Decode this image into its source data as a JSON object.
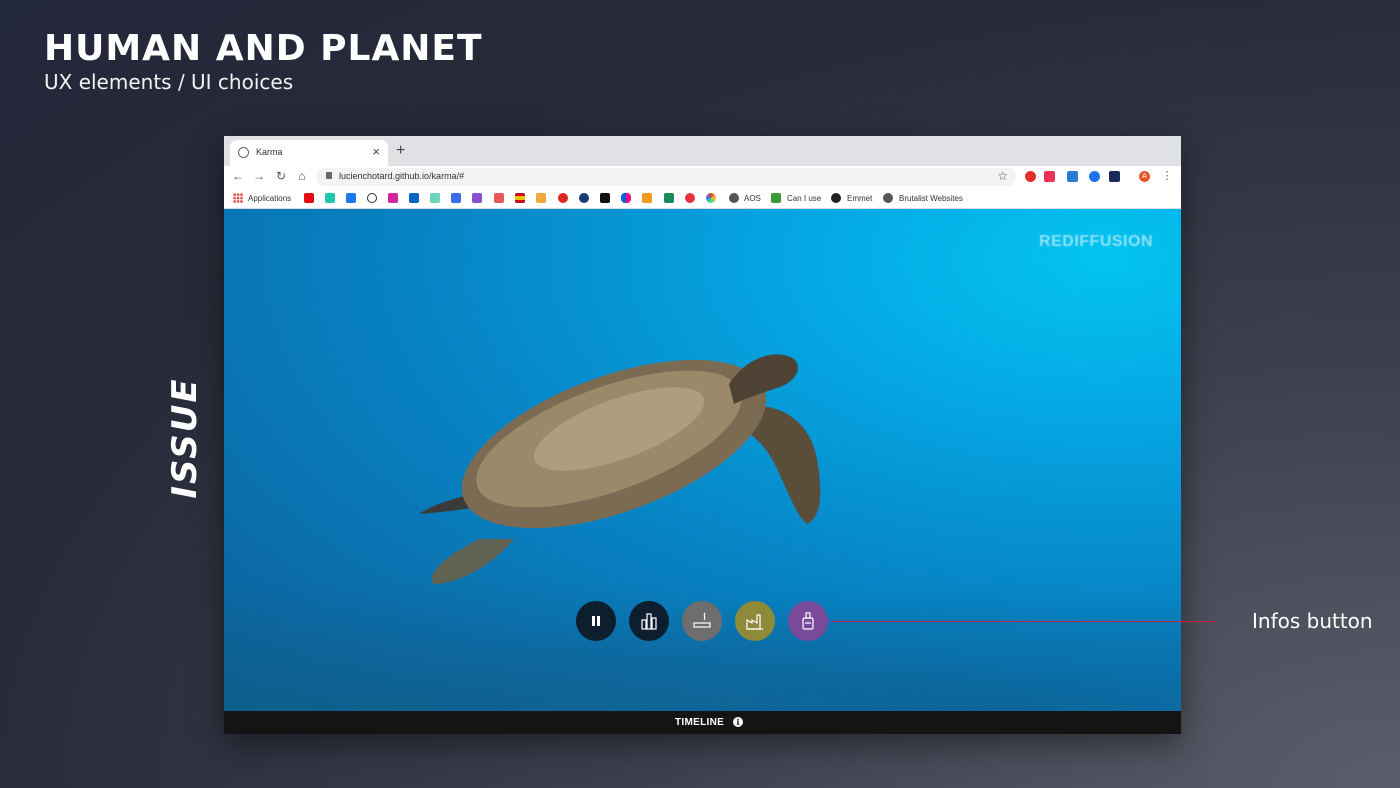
{
  "slide": {
    "title": "HUMAN AND PLANET",
    "subtitle": "UX elements / UI choices",
    "side_label": "ISSUE"
  },
  "browser": {
    "tab": {
      "title": "Karma",
      "close_glyph": "×"
    },
    "new_tab_glyph": "+",
    "nav": {
      "back_glyph": "←",
      "forward_glyph": "→",
      "reload_glyph": "↻",
      "home_glyph": "⌂"
    },
    "address": {
      "url": "lucienchotard.github.io/karma/#",
      "star_glyph": "☆"
    },
    "menu_glyph": "⋮",
    "profile_initial": "A",
    "bookmarks": [
      {
        "label": "Applications",
        "icon": "apps-grid-icon"
      },
      {
        "label": "AOS",
        "icon": "globe-icon"
      },
      {
        "label": "Can I use",
        "icon": "caniuse-icon"
      },
      {
        "label": "Emmet",
        "icon": "emmet-icon"
      },
      {
        "label": "Brutalist Websites",
        "icon": "globe-icon"
      }
    ]
  },
  "video": {
    "watermark": "REDIFFUSION",
    "controls": [
      {
        "name": "pause",
        "icon": "pause-icon",
        "color": "#0d1e2e"
      },
      {
        "name": "city",
        "icon": "city-icon",
        "color": "#0d1e2e"
      },
      {
        "name": "smoking",
        "icon": "cigarette-icon",
        "color": "#6e6e6e"
      },
      {
        "name": "industry",
        "icon": "factory-icon",
        "color": "#8f8a3a"
      },
      {
        "name": "infos",
        "icon": "bottle-icon",
        "color": "#7a4a9a"
      }
    ]
  },
  "timeline": {
    "label": "TIMELINE",
    "info_glyph": "i"
  },
  "callout": {
    "label": "Infos button",
    "line_color": "#c4203a"
  }
}
